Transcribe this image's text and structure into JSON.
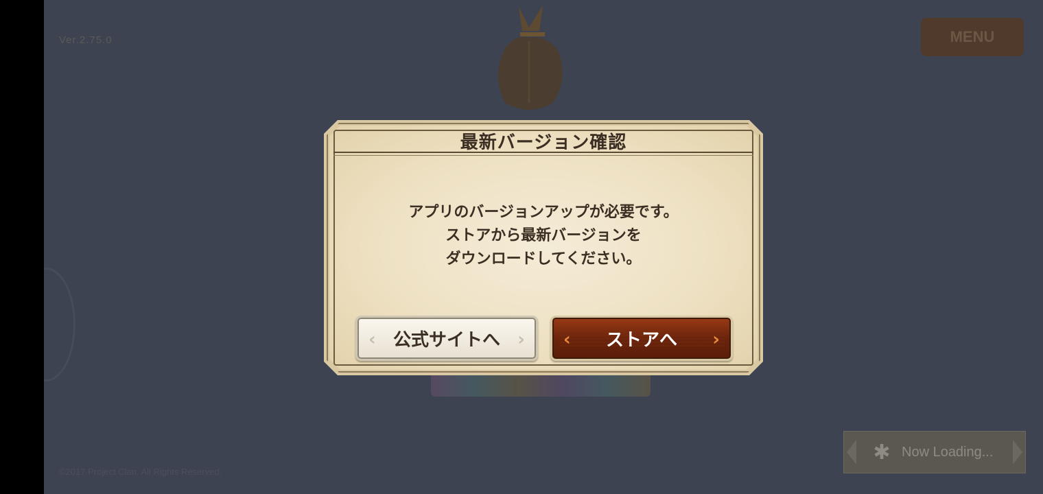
{
  "background": {
    "version": "Ver.2.75.0",
    "menu_label": "MENU",
    "copyright": "©2017 Project Clan. All Rights Reserved."
  },
  "dialog": {
    "title": "最新バージョン確認",
    "message_lines": [
      "アプリのバージョンアップが必要です。",
      "ストアから最新バージョンを",
      "ダウンロードしてください。"
    ],
    "buttons": {
      "official_site": "公式サイトへ",
      "store": "ストアへ"
    }
  },
  "loading": {
    "label": "Now Loading..."
  },
  "colors": {
    "backdrop": "#3e4352",
    "paper": "#efe3c6",
    "text": "#3b2e22",
    "store_button": "#6b240c"
  }
}
